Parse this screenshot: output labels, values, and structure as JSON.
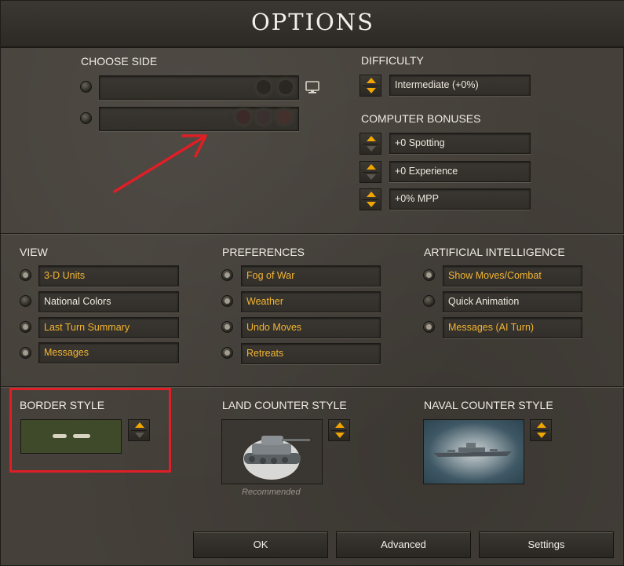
{
  "title": "OPTIONS",
  "choose_side": {
    "heading": "CHOOSE SIDE",
    "sides": [
      {
        "selected": false,
        "flags": 2,
        "icon": "monitor-icon"
      },
      {
        "selected": false,
        "flags": 3,
        "icon": ""
      }
    ]
  },
  "difficulty": {
    "heading": "DIFFICULTY",
    "value": "Intermediate (+0%)"
  },
  "computer_bonuses": {
    "heading": "COMPUTER BONUSES",
    "items": [
      "+0 Spotting",
      "+0 Experience",
      "+0% MPP"
    ]
  },
  "view": {
    "heading": "VIEW",
    "items": [
      {
        "label": "3-D Units",
        "on": true
      },
      {
        "label": "National Colors",
        "on": false
      },
      {
        "label": "Last Turn Summary",
        "on": true
      },
      {
        "label": "Messages",
        "on": true
      }
    ]
  },
  "preferences": {
    "heading": "PREFERENCES",
    "items": [
      {
        "label": "Fog of War",
        "on": true
      },
      {
        "label": "Weather",
        "on": true
      },
      {
        "label": "Undo Moves",
        "on": true
      },
      {
        "label": "Retreats",
        "on": true
      }
    ]
  },
  "ai": {
    "heading": "ARTIFICIAL INTELLIGENCE",
    "items": [
      {
        "label": "Show Moves/Combat",
        "on": true
      },
      {
        "label": "Quick Animation",
        "on": false
      },
      {
        "label": "Messages (AI Turn)",
        "on": true
      }
    ]
  },
  "border_style": {
    "heading": "BORDER STYLE"
  },
  "land_counter": {
    "heading": "LAND COUNTER STYLE",
    "caption": "Recommended"
  },
  "naval_counter": {
    "heading": "NAVAL COUNTER STYLE"
  },
  "buttons": {
    "ok": "OK",
    "advanced": "Advanced",
    "settings": "Settings"
  },
  "colors": {
    "accent": "#f2b530",
    "highlight": "#e01e26",
    "background": "#45403a"
  }
}
